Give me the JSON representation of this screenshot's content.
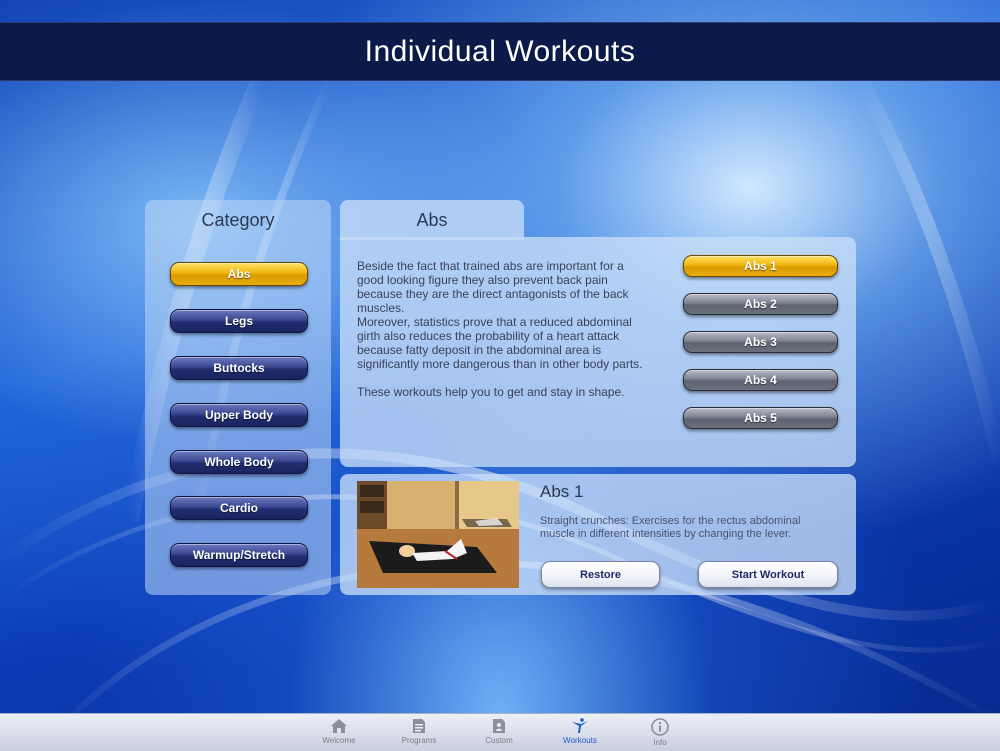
{
  "header": {
    "title": "Individual Workouts"
  },
  "category": {
    "title": "Category",
    "items": [
      {
        "label": "Abs",
        "selected": true
      },
      {
        "label": "Legs",
        "selected": false
      },
      {
        "label": "Buttocks",
        "selected": false
      },
      {
        "label": "Upper Body",
        "selected": false
      },
      {
        "label": "Whole Body",
        "selected": false
      },
      {
        "label": "Cardio",
        "selected": false
      },
      {
        "label": "Warmup/Stretch",
        "selected": false
      }
    ]
  },
  "details": {
    "tab_label": "Abs",
    "description": [
      "Beside the fact that trained abs are important for a good looking figure they also prevent back pain because they are the direct antagonists of the back muscles.",
      "Moreover, statistics prove that a reduced abdominal girth also reduces the probability of a heart attack because fatty deposit in the abdominal area is significantly more dangerous than in other body parts.",
      "These workouts help you to get and stay in shape."
    ],
    "workouts": [
      {
        "label": "Abs 1",
        "selected": true
      },
      {
        "label": "Abs 2",
        "selected": false
      },
      {
        "label": "Abs 3",
        "selected": false
      },
      {
        "label": "Abs 4",
        "selected": false
      },
      {
        "label": "Abs 5",
        "selected": false
      }
    ]
  },
  "selected_workout": {
    "title": "Abs 1",
    "description": "Straight crunches: Exercises for the rectus abdominal muscle in different intensities by changing the lever.",
    "restore_label": "Restore",
    "start_label": "Start Workout"
  },
  "tabbar": {
    "items": [
      {
        "label": "Welcome",
        "icon": "home-icon",
        "active": false
      },
      {
        "label": "Programs",
        "icon": "document-icon",
        "active": false
      },
      {
        "label": "Custom",
        "icon": "custom-doc-icon",
        "active": false
      },
      {
        "label": "Workouts",
        "icon": "figure-icon",
        "active": true
      },
      {
        "label": "Info",
        "icon": "info-icon",
        "active": false
      }
    ]
  },
  "colors": {
    "accent": "#1c5fcf",
    "header": "#0c1a4a",
    "selected_gold": "#f0b60a",
    "button_navy": "#2a3780"
  }
}
